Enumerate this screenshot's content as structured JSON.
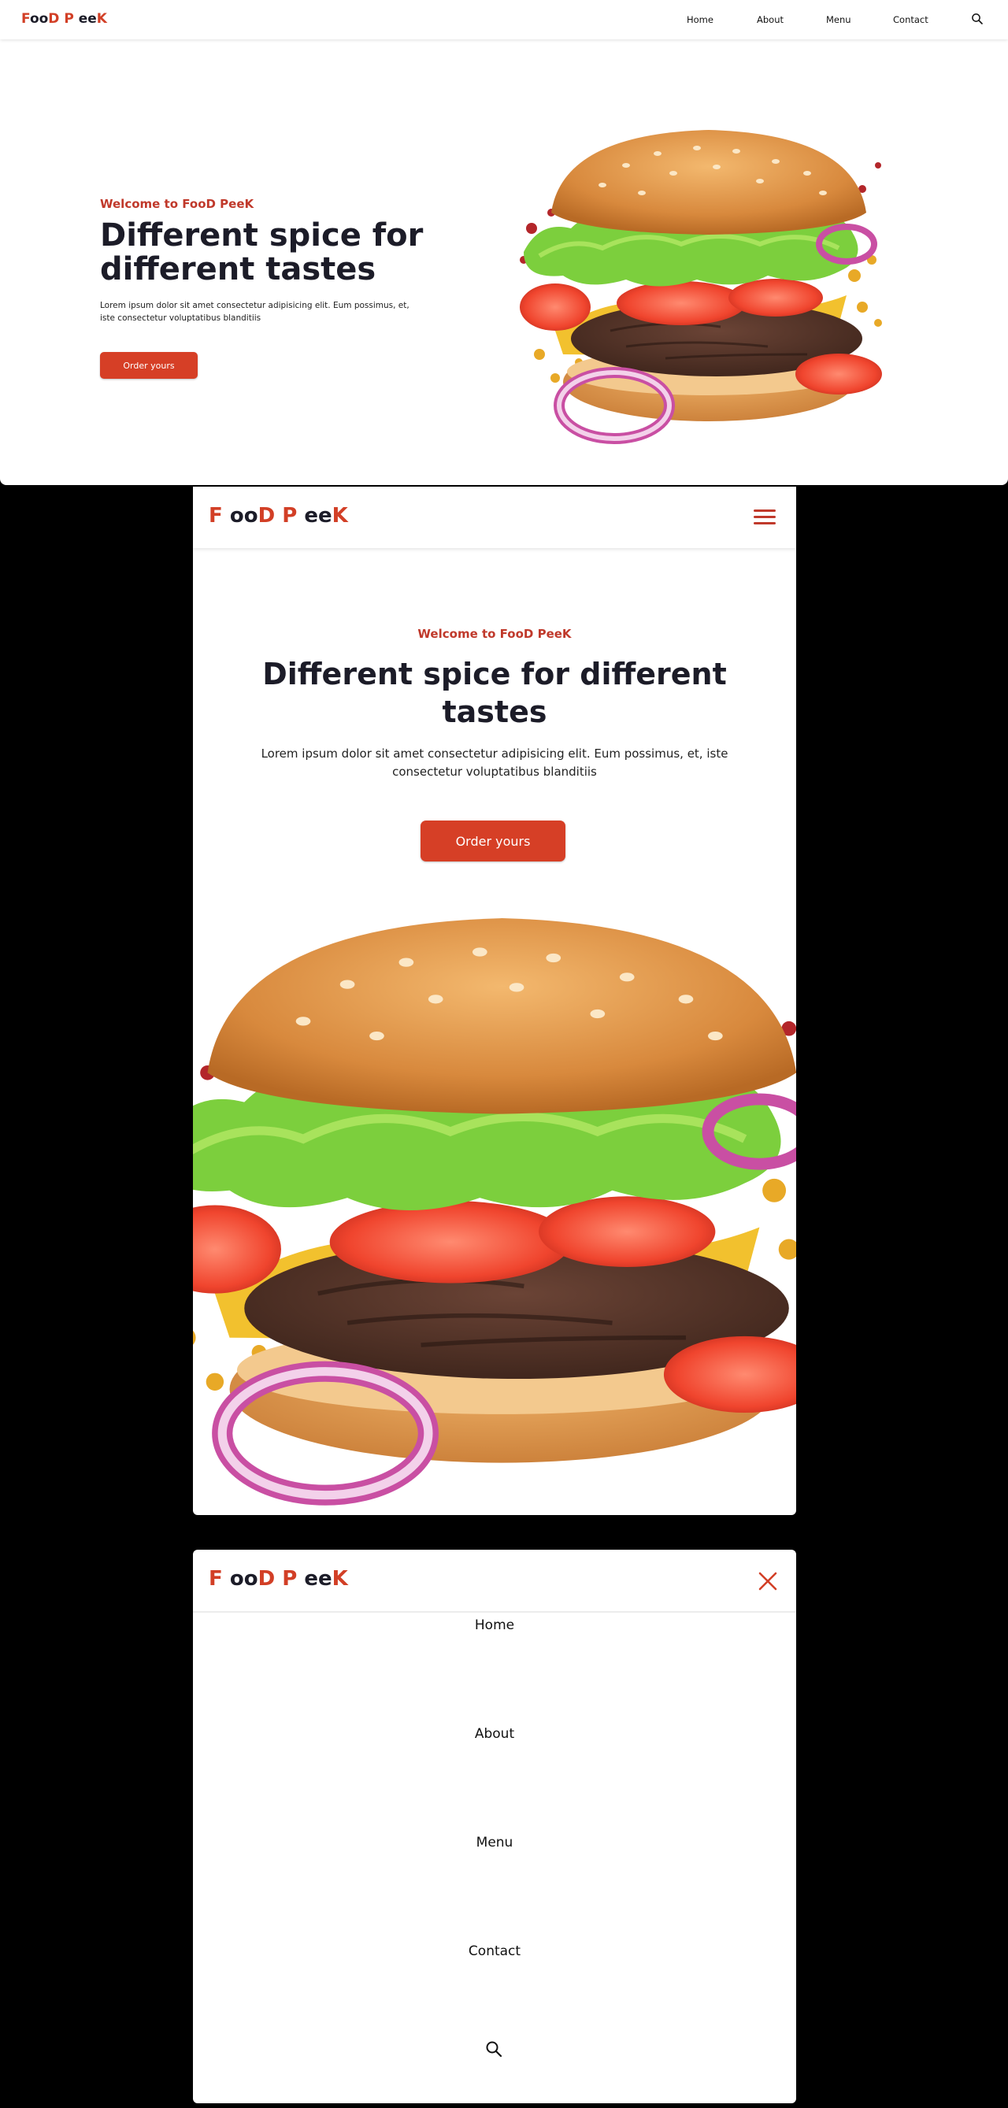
{
  "brand": {
    "logo_parts": [
      {
        "text": "F",
        "tone": "red"
      },
      {
        "text": "oo",
        "tone": "dark"
      },
      {
        "text": "D",
        "tone": "red"
      },
      {
        "text": "P",
        "tone": "red"
      },
      {
        "text": "ee",
        "tone": "dark"
      },
      {
        "text": "K",
        "tone": "red"
      }
    ],
    "colors": {
      "accent": "#d63f26",
      "heading": "#1c1c28",
      "background": "#ffffff",
      "backdrop": "#000000"
    }
  },
  "nav": {
    "links": [
      "Home",
      "About",
      "Menu",
      "Contact"
    ],
    "search_icon": "search-icon"
  },
  "hero": {
    "welcome": "Welcome to FooD PeeK",
    "headline": "Different spice for different tastes",
    "description": "Lorem ipsum dolor sit amet consectetur adipisicing elit. Eum possimus, et, iste consectetur voluptatibus blanditiis",
    "cta_label": "Order yours",
    "image": "burger-illustration"
  },
  "mobile_nav": {
    "menu_icon": "hamburger-menu-icon",
    "close_icon": "close-icon",
    "items": [
      "Home",
      "About",
      "Menu",
      "Contact"
    ],
    "search_icon": "search-icon"
  }
}
